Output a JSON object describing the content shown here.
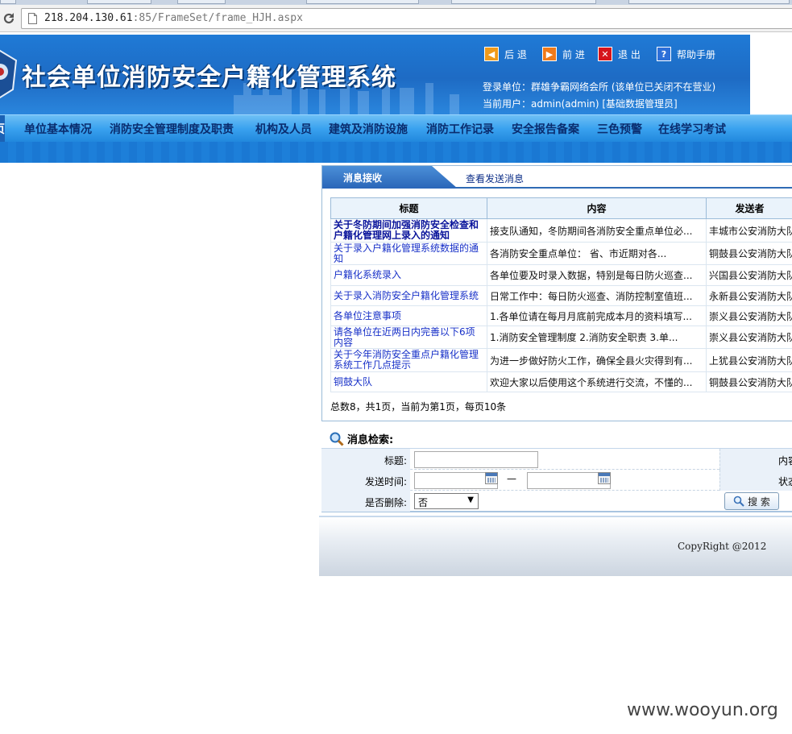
{
  "browser": {
    "url_host": "218.204.130.61",
    "url_rest": ":85/FrameSet/frame_HJH.aspx"
  },
  "header": {
    "system_title": "社会单位消防安全户籍化管理系统",
    "nav": {
      "back": "后 退",
      "forward": "前 进",
      "exit": "退 出",
      "help": "帮助手册"
    },
    "login_unit": "登录单位：群雄争霸网络会所 (该单位已关闭不在营业)",
    "current_user": "当前用户：admin(admin) [基础数据管理员]"
  },
  "menu": {
    "first_partial": "页",
    "items": [
      "单位基本情况",
      "消防安全管理制度及职责",
      "机构及人员",
      "建筑及消防设施",
      "消防工作记录",
      "安全报告备案",
      "三色预警",
      "在线学习考试"
    ]
  },
  "messages": {
    "tab_active": "消息接收",
    "tab_other": "查看发送消息",
    "columns": [
      "标题",
      "内容",
      "发送者"
    ],
    "rows": [
      {
        "title": "关于冬防期间加强消防安全检查和户籍化管理网上录入的通知",
        "content": "接支队通知，冬防期间各消防安全重点单位必...",
        "sender": "丰城市公安消防大队"
      },
      {
        "title": "关于录入户籍化管理系统数据的通知",
        "content": "各消防安全重点单位： 省、市近期对各...",
        "sender": "铜鼓县公安消防大队"
      },
      {
        "title": "户籍化系统录入",
        "content": "各单位要及时录入数据，特别是每日防火巡查...",
        "sender": "兴国县公安消防大队"
      },
      {
        "title": "关于录入消防安全户籍化管理系统",
        "content": "日常工作中：每日防火巡查、消防控制室值班...",
        "sender": "永新县公安消防大队"
      },
      {
        "title": "各单位注意事项",
        "content": "1.各单位请在每月月底前完成本月的资料填写...",
        "sender": "崇义县公安消防大队"
      },
      {
        "title": "请各单位在近两日内完善以下6项内容",
        "content": "1.消防安全管理制度 2.消防安全职责 3.单...",
        "sender": "崇义县公安消防大队"
      },
      {
        "title": "关于今年消防安全重点户籍化管理系统工作几点提示",
        "content": "为进一步做好防火工作，确保全县火灾得到有...",
        "sender": "上犹县公安消防大队"
      },
      {
        "title": "铜鼓大队",
        "content": "欢迎大家以后使用这个系统进行交流，不懂的...",
        "sender": "铜鼓县公安消防大队"
      }
    ],
    "pager": "总数8，共1页，当前为第1页，每页10条"
  },
  "search": {
    "heading": "消息检索:",
    "title_label": "标题:",
    "content_label": "内容",
    "time_label": "发送时间:",
    "time_sep": "—",
    "status_label": "状态",
    "deleted_label": "是否删除:",
    "deleted_value": "否",
    "button": "搜 索"
  },
  "footer": {
    "copyright": "CopyRight @2012"
  },
  "watermark": "www.wooyun.org"
}
